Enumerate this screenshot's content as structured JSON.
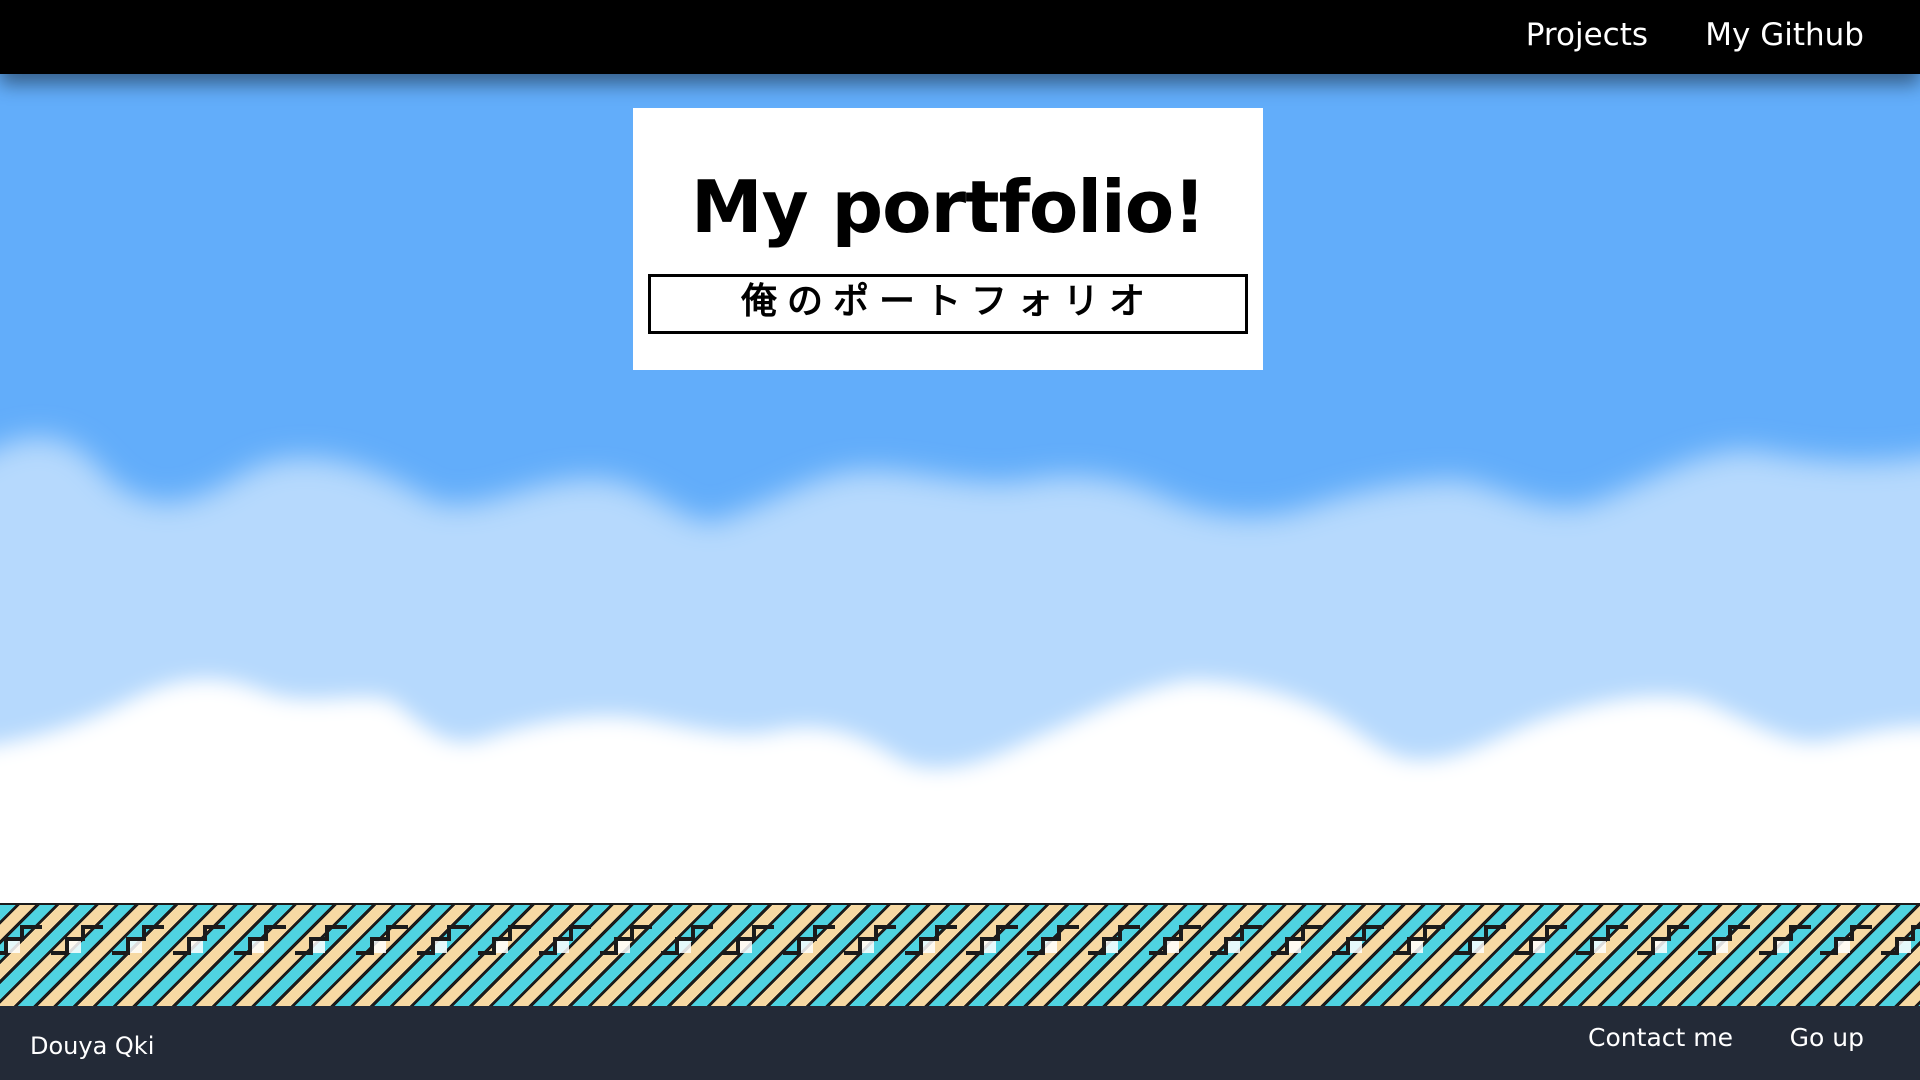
{
  "nav": {
    "projects_label": "Projects",
    "github_label": "My Github"
  },
  "hero": {
    "title": "My portfolio!",
    "subtitle": "俺のポートフォリオ"
  },
  "footer": {
    "name": "Douya Qki",
    "contact_label": "Contact me",
    "go_up_label": "Go up"
  },
  "colors": {
    "sky": "#62adfa",
    "sky_light": "#b6d9fd",
    "cloud": "#ffffff",
    "topbar": "#000000",
    "footer": "#232a37",
    "stripe_cyan": "#4fd3e1",
    "stripe_tan": "#f7d9a3",
    "stripe_dark": "#1b1b1b"
  }
}
